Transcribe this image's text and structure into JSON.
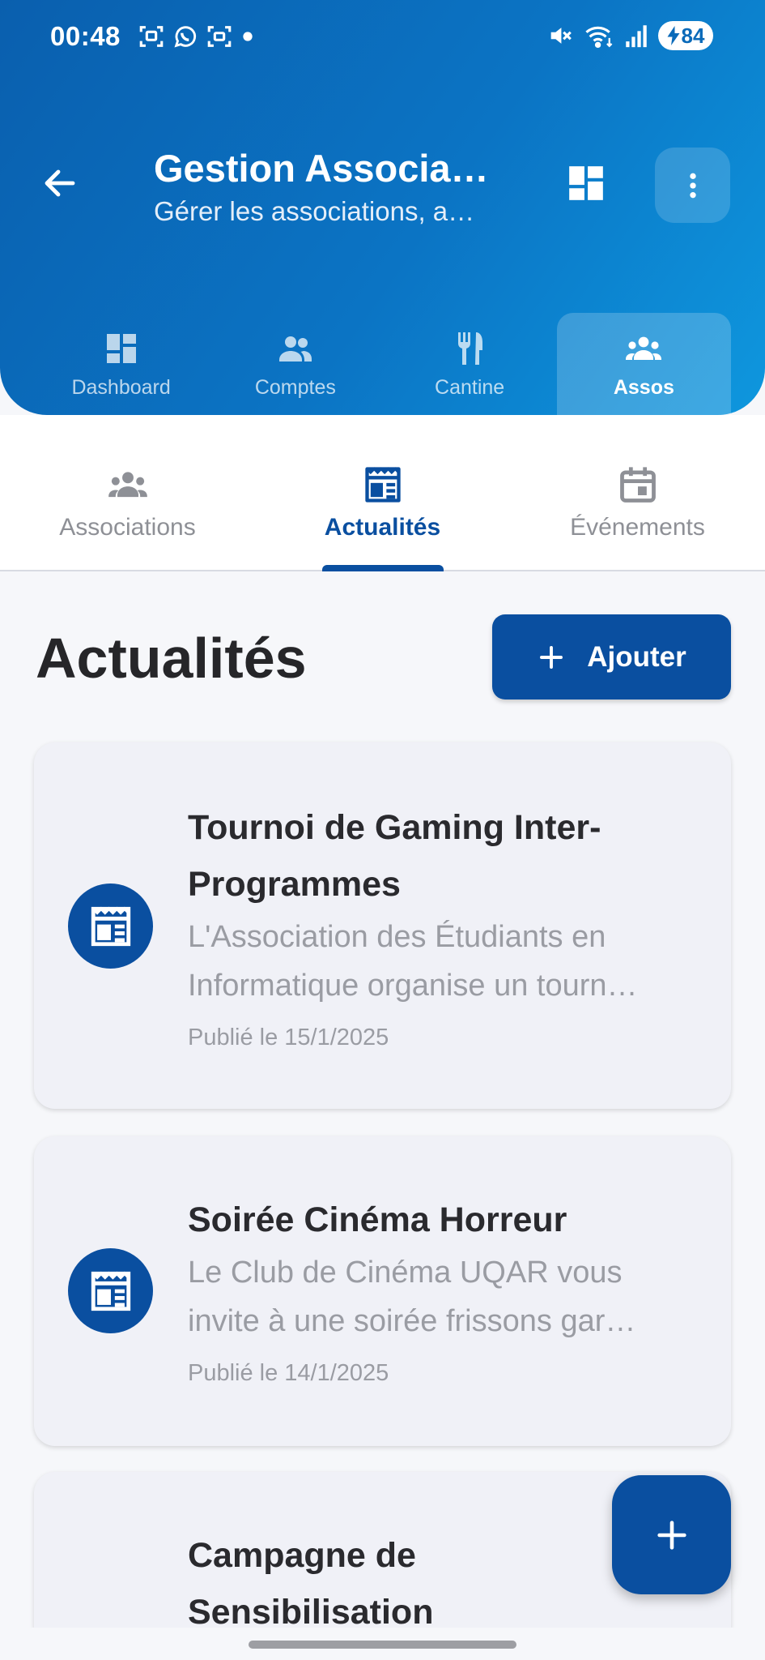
{
  "status_bar": {
    "time": "00:48",
    "battery": "84",
    "left_icons": [
      "screenshot-icon",
      "whatsapp-icon",
      "scan-icon",
      "dot-icon"
    ],
    "right_icons": [
      "mute-icon",
      "wifi-icon",
      "signal-icon",
      "battery-icon"
    ]
  },
  "appbar": {
    "title": "Gestion Associa…",
    "subtitle": "Gérer les associations, a…",
    "back_icon": "arrow-back-icon",
    "dashboard_icon": "dashboard-grid-icon",
    "more_icon": "more-vertical-icon"
  },
  "nav_tabs": [
    {
      "label": "Dashboard",
      "icon": "dashboard-icon",
      "active": false
    },
    {
      "label": "Comptes",
      "icon": "people-icon",
      "active": false
    },
    {
      "label": "Cantine",
      "icon": "restaurant-icon",
      "active": false
    },
    {
      "label": "Assos",
      "icon": "groups-icon",
      "active": true
    }
  ],
  "sub_tabs": [
    {
      "label": "Associations",
      "icon": "groups-icon",
      "active": false
    },
    {
      "label": "Actualités",
      "icon": "newspaper-icon",
      "active": true
    },
    {
      "label": "Événements",
      "icon": "calendar-icon",
      "active": false
    }
  ],
  "main": {
    "title": "Actualités",
    "add_button_label": "Ajouter"
  },
  "news": [
    {
      "title_lines": [
        "Tournoi de Gaming Inter-",
        "Programmes"
      ],
      "desc_lines": [
        "L'Association des Étudiants en",
        "Informatique organise un tourn…"
      ],
      "date": "Publié le 15/1/2025"
    },
    {
      "title_lines": [
        "Soirée Cinéma Horreur"
      ],
      "desc_lines": [
        "Le Club de Cinéma UQAR vous",
        "invite à une soirée frissons gar…"
      ],
      "date": "Publié le 14/1/2025"
    },
    {
      "title_lines": [
        "Campagne de",
        "Sensibilisation"
      ],
      "desc_lines": [],
      "date": ""
    }
  ],
  "colors": {
    "primary": "#0a4fa0",
    "header_gradient_start": "#0a5fae",
    "header_gradient_end": "#0e97de",
    "background": "#f6f7fa",
    "card": "#f0f1f7",
    "muted_text": "#9a9ca3"
  }
}
